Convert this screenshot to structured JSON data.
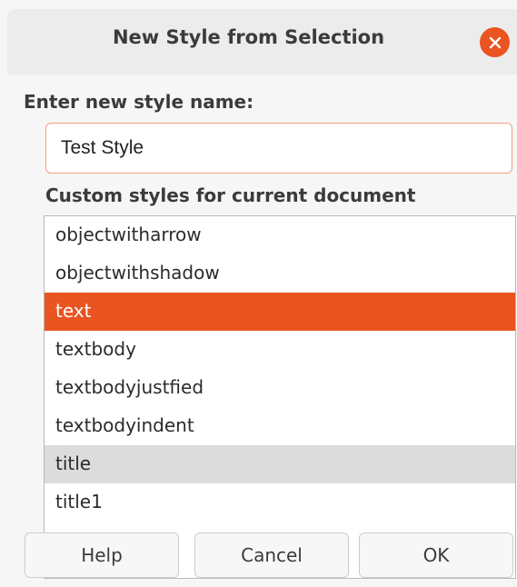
{
  "dialog": {
    "title": "New Style from Selection",
    "name_label": "Enter new style name:",
    "name_value": "Test Style",
    "list_label": "Custom styles for current document",
    "styles": [
      "objectwitharrow",
      "objectwithshadow",
      "text",
      "textbody",
      "textbodyjustfied",
      "textbodyindent",
      "title",
      "title1"
    ],
    "selected_style": "text",
    "hovered_style": "title",
    "buttons": {
      "help": "Help",
      "cancel": "Cancel",
      "ok": "OK"
    }
  },
  "colors": {
    "accent": "#e95420",
    "input_border": "#f0a080",
    "hover": "#dcdcdc"
  },
  "icons": {
    "close": "close-icon"
  }
}
